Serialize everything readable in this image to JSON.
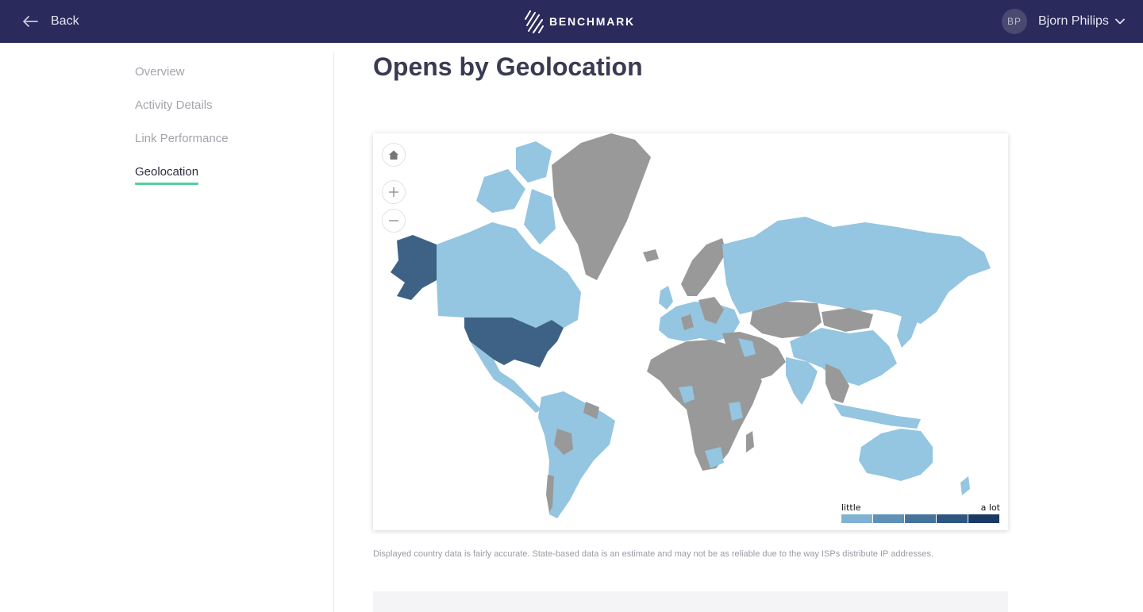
{
  "header": {
    "back_label": "Back",
    "brand_name": "BENCHMARK",
    "user_initials": "BP",
    "user_name": "Bjorn Philips",
    "brand_color": "#2a2a5c"
  },
  "sidebar": {
    "items": [
      {
        "label": "Overview",
        "active": false
      },
      {
        "label": "Activity Details",
        "active": false
      },
      {
        "label": "Link Performance",
        "active": false
      },
      {
        "label": "Geolocation",
        "active": true
      }
    ],
    "active_underline_color": "#52d09a"
  },
  "main": {
    "title": "Opens by Geolocation",
    "disclaimer": "Displayed country data is fairly accurate. State-based data is an estimate and may not be as reliable due to the way ISPs distribute IP addresses."
  },
  "map": {
    "controls": [
      "home-icon",
      "zoom-in-icon",
      "zoom-out-icon"
    ],
    "colors": {
      "none": "#999999",
      "low": "#94c5e1",
      "high": "#3e6285",
      "ocean": "#ffffff"
    },
    "legend": {
      "low_label": "little",
      "high_label": "a lot",
      "scale_colors": [
        "#7fb2d3",
        "#5f91b7",
        "#46739b",
        "#2e5680",
        "#1a3a63"
      ]
    }
  }
}
